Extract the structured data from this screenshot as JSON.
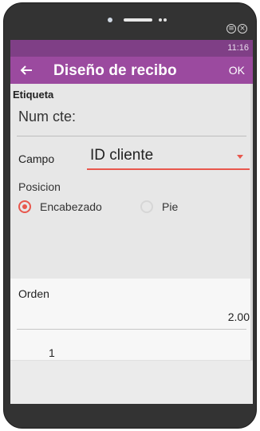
{
  "status_bar": {
    "time": "11:16"
  },
  "app_bar": {
    "title": "Diseño de recibo",
    "ok_label": "OK"
  },
  "form": {
    "etiqueta_label": "Etiqueta",
    "etiqueta_value": "Num cte:",
    "campo_label": "Campo",
    "campo_value": "ID cliente",
    "posicion_label": "Posicion",
    "posicion_options": [
      {
        "label": "Encabezado",
        "checked": true
      },
      {
        "label": "Pie",
        "checked": false
      }
    ],
    "orden_label": "Orden",
    "orden_value": "2.00"
  },
  "list": {
    "items": [
      "1"
    ]
  },
  "colors": {
    "status_bar": "#7f3f86",
    "app_bar": "#9b4a9f",
    "accent": "#e8574d",
    "device_frame": "#333333"
  },
  "icons": {
    "back": "back-arrow-icon",
    "menu": "menu-circle-icon",
    "close": "close-circle-icon",
    "dropdown": "chevron-down-icon"
  }
}
